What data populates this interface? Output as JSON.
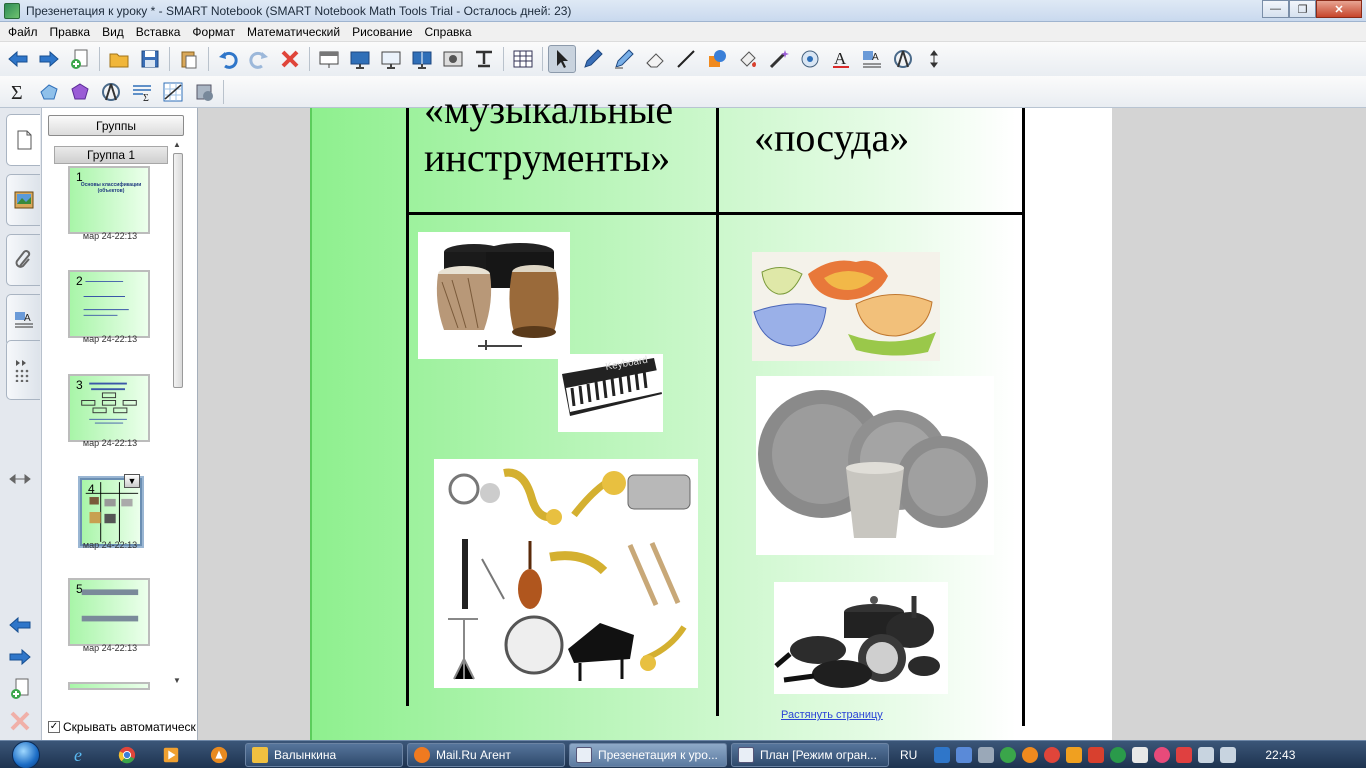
{
  "window": {
    "title": "Презенетация к уроку * - SMART Notebook (SMART Notebook Math Tools Trial - Осталось дней: 23)"
  },
  "menu": [
    "Файл",
    "Правка",
    "Вид",
    "Вставка",
    "Формат",
    "Математический",
    "Рисование",
    "Справка"
  ],
  "toolbar1_icons": [
    "back-arrow-icon",
    "forward-arrow-icon",
    "add-page-icon",
    "open-folder-icon",
    "save-icon",
    "paste-icon",
    "undo-icon",
    "redo-icon",
    "delete-icon",
    "screen-shade-icon",
    "full-screen-icon",
    "transparent-background-icon",
    "dual-page-icon",
    "capture-icon",
    "document-camera-icon",
    "table-icon",
    "select-icon",
    "pen-icon",
    "creative-pen-icon",
    "eraser-icon",
    "line-icon",
    "shapes-icon",
    "fill-icon",
    "magic-pen-icon",
    "properties-icon",
    "text-icon",
    "handwriting-icon",
    "measurement-icon",
    "move-toolbar-icon"
  ],
  "toolbar2_icons": [
    "sigma-icon",
    "shape-3d-icon",
    "solid-icon",
    "compass-icon",
    "equation-icon",
    "graph-icon",
    "math-tools-icon"
  ],
  "sorter": {
    "groups_button": "Группы",
    "group_label": "Группа 1",
    "pages": [
      {
        "num": "1",
        "title": "Основы классификации (объектов)",
        "date": "мар 24-22:13"
      },
      {
        "num": "2",
        "title": "",
        "date": "мар 24-22:13"
      },
      {
        "num": "3",
        "title": "",
        "date": "мар 24-22:13"
      },
      {
        "num": "4",
        "title": "",
        "date": "мар 24-22:13"
      },
      {
        "num": "5",
        "title": "",
        "date": "мар 24-22:13"
      }
    ],
    "autohide_label": "Скрывать автоматическ"
  },
  "canvas": {
    "heading_left_top": "«музыкальные",
    "heading_left_bottom": "инструменты»",
    "heading_right": "«посуда»",
    "stretch_link": "Растянуть страницу"
  },
  "taskbar": {
    "tasks": [
      "Валынкина",
      "Mail.Ru Агент",
      "Презенетация к уро...",
      "План [Режим огран..."
    ],
    "lang": "RU",
    "clock": "22:43"
  }
}
